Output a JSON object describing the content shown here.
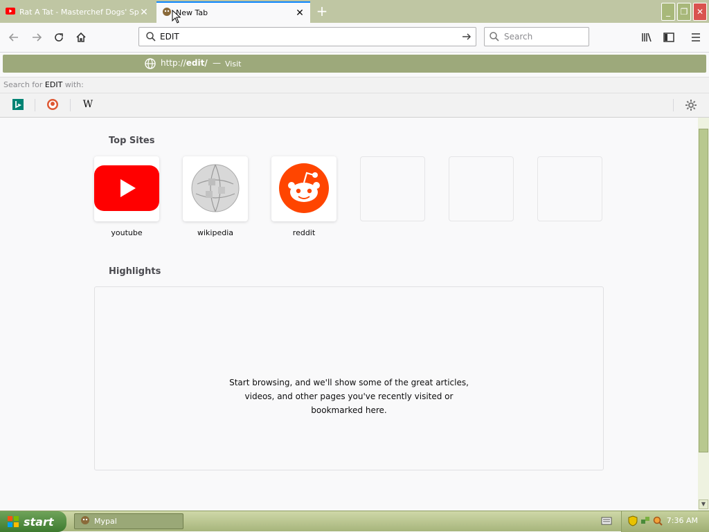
{
  "tabs": [
    {
      "label": "Rat A Tat - Masterchef Dogs' Spe",
      "favicon": "youtube-icon",
      "active": false
    },
    {
      "label": "New Tab",
      "favicon": "mypal-icon",
      "active": true
    }
  ],
  "navbar": {
    "url_value": "EDIT",
    "search_placeholder": "Search"
  },
  "suggestion": {
    "url_prefix": "http://",
    "url_host": "edit/",
    "dash": "—",
    "visit_label": "Visit"
  },
  "search_with": {
    "prefix": "Search for",
    "term": "EDIT",
    "suffix": "with:"
  },
  "engines": [
    {
      "name": "bing-icon"
    },
    {
      "name": "duckduckgo-icon"
    },
    {
      "name": "wikipedia-icon",
      "glyph": "W"
    }
  ],
  "content": {
    "top_sites_title": "Top Sites",
    "top_sites": [
      {
        "label": "youtube"
      },
      {
        "label": "wikipedia"
      },
      {
        "label": "reddit"
      },
      {
        "label": ""
      },
      {
        "label": ""
      },
      {
        "label": ""
      }
    ],
    "highlights_title": "Highlights",
    "highlights_message_line1": "Start browsing, and we'll show some of the great articles,",
    "highlights_message_line2": "videos, and other pages you've recently visited or",
    "highlights_message_line3": "bookmarked here."
  },
  "taskbar": {
    "start_label": "start",
    "task_label": "Mypal",
    "clock": "7:36 AM"
  },
  "colors": {
    "accent": "#0a84ff",
    "theme_olive": "#9da97b",
    "youtube_red": "#ff0000",
    "reddit_orange": "#ff4500"
  }
}
